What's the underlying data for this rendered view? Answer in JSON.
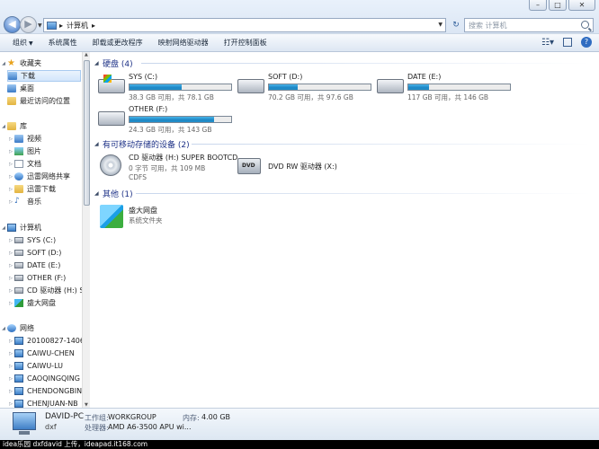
{
  "address": {
    "crumbs": [
      "计算机"
    ],
    "search_placeholder": "搜索 计算机"
  },
  "toolbar": {
    "organize": "组织",
    "system_properties": "系统属性",
    "uninstall": "卸载或更改程序",
    "map_drive": "映射网络驱动器",
    "control_panel": "打开控制面板"
  },
  "nav": {
    "favorites": "收藏夹",
    "downloads": "下载",
    "desktop": "桌面",
    "recent": "最近访问的位置",
    "libraries": "库",
    "videos": "视频",
    "pictures": "图片",
    "documents": "文档",
    "xunlei_share": "迅雷网络共享",
    "xunlei_dl": "迅雷下载",
    "music": "音乐",
    "computer": "计算机",
    "sys": "SYS (C:)",
    "soft": "SOFT (D:)",
    "date": "DATE (E:)",
    "other": "OTHER (F:)",
    "cd": "CD 驱动器 (H:) S",
    "cloud": "盛大网盘",
    "network": "网络",
    "net_items": [
      "20100827-1406",
      "CAIWU-CHEN",
      "CAIWU-LU",
      "CAOQINGQING",
      "CHENDONGBIN",
      "CHENJUAN-NB"
    ]
  },
  "groups": {
    "hdd": "硬盘 (4)",
    "removable": "有可移动存储的设备 (2)",
    "other": "其他 (1)"
  },
  "drives": [
    {
      "name": "SYS (C:)",
      "free": "38.3 GB 可用，共 78.1 GB",
      "used_fraction": 0.51
    },
    {
      "name": "SOFT (D:)",
      "free": "70.2 GB 可用，共 97.6 GB",
      "used_fraction": 0.28
    },
    {
      "name": "DATE (E:)",
      "free": "117 GB 可用，共 146 GB",
      "used_fraction": 0.2
    },
    {
      "name": "OTHER (F:)",
      "free": "24.3 GB 可用，共 143 GB",
      "used_fraction": 0.83
    }
  ],
  "removable": {
    "cd": {
      "name": "CD 驱动器 (H:) SUPER BOOTCD",
      "free": "0 字节 可用，共 109 MB",
      "fs": "CDFS"
    },
    "dvd": {
      "name": "DVD RW 驱动器 (X:)",
      "badge": "DVD"
    }
  },
  "other_items": [
    {
      "name": "盛大网盘",
      "type": "系统文件夹"
    }
  ],
  "details": {
    "pc_name": "DAVID-PC",
    "user": "dxf",
    "workgroup_label": "工作组:",
    "workgroup": "WORKGROUP",
    "memory_label": "内存:",
    "memory": "4.00 GB",
    "cpu_label": "处理器:",
    "cpu": "AMD A6-3500 APU wi..."
  },
  "watermark": "idea乐园 dxfdavid 上传，ideapad.it168.com",
  "colors": {
    "bar_fill": "#1d86c4",
    "group_header": "#1e3287"
  }
}
